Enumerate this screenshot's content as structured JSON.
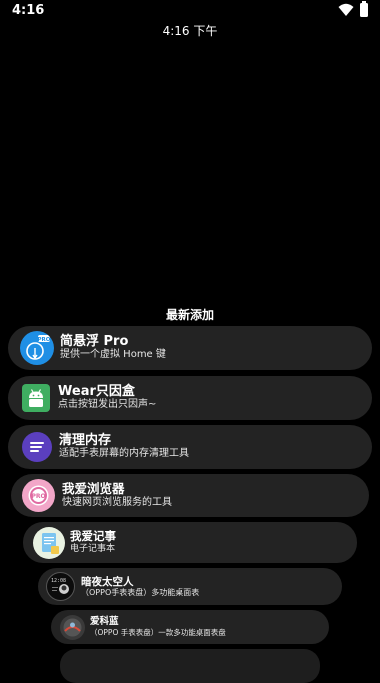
{
  "status_bar": {
    "time": "4:16"
  },
  "clock": "4:16 下午",
  "section_title": "最新添加",
  "apps": [
    {
      "title": "简悬浮 Pro",
      "subtitle": "提供一个虚拟 Home 键",
      "icon": "floating-ball-icon"
    },
    {
      "title": "Wear只因盒",
      "subtitle": "点击按钮发出只因声~",
      "icon": "android-icon"
    },
    {
      "title": "清理内存",
      "subtitle": "适配手表屏幕的内存清理工具",
      "icon": "memory-clean-icon"
    },
    {
      "title": "我爱浏览器",
      "subtitle": "快速网页浏览服务的工具",
      "icon": "browser-icon"
    },
    {
      "title": "我爱记事",
      "subtitle": "电子记事本",
      "icon": "notes-icon"
    },
    {
      "title": "暗夜太空人",
      "subtitle": "（OPPO手表表盘）多功能桌面表",
      "icon": "astronaut-watchface-icon"
    },
    {
      "title": "爱科蓝",
      "subtitle": "（OPPO 手表表盘）一款多功能桌面表盘",
      "icon": "watchface-icon"
    }
  ]
}
